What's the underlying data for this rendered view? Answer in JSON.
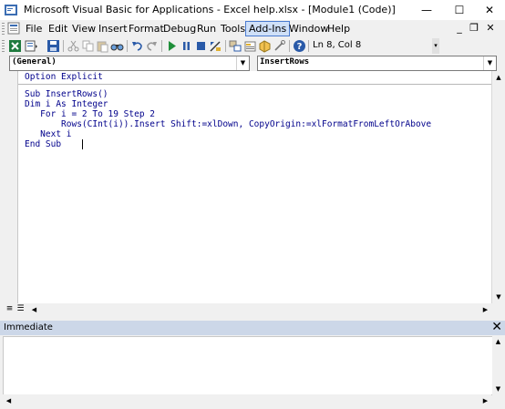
{
  "window": {
    "title": "Microsoft Visual Basic for Applications - Excel help.xlsx - [Module1 (Code)]",
    "minimize": "—",
    "maximize": "☐",
    "close": "✕"
  },
  "menu": {
    "items": [
      "File",
      "Edit",
      "View",
      "Insert",
      "Format",
      "Debug",
      "Run",
      "Tools",
      "Add-Ins",
      "Window",
      "Help"
    ],
    "active": "Add-Ins",
    "mdi_minimize": "_",
    "mdi_restore": "❐",
    "mdi_close": "✕"
  },
  "toolbar": {
    "icons": [
      "excel-icon",
      "insert-module-icon",
      "save-icon",
      "cut-icon",
      "copy-icon",
      "paste-icon",
      "find-icon",
      "undo-icon",
      "redo-icon",
      "run-icon",
      "break-icon",
      "reset-icon",
      "design-mode-icon",
      "project-explorer-icon",
      "properties-icon",
      "object-browser-icon",
      "toolbox-icon",
      "help-icon"
    ],
    "position": "Ln 8, Col 8"
  },
  "code_window": {
    "object_combo": "(General)",
    "procedure_combo": "InsertRows",
    "lines": [
      "Option Explicit",
      "Sub InsertRows()",
      "Dim i As Integer",
      "   For i = 2 To 19 Step 2",
      "       Rows(CInt(i)).Insert Shift:=xlDown, CopyOrigin:=xlFormatFromLeftOrAbove",
      "   Next i",
      "End Sub"
    ]
  },
  "immediate": {
    "title": "Immediate",
    "close": "✕"
  }
}
